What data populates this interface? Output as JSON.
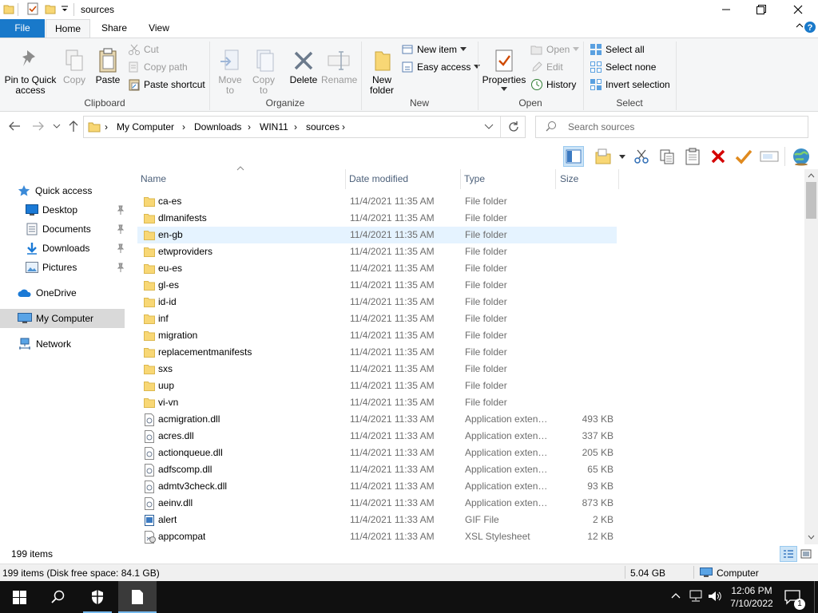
{
  "window": {
    "title": "sources",
    "controls": {
      "minimize": "minimize",
      "maximize": "maximize",
      "close": "close"
    }
  },
  "ribbon": {
    "tabs": [
      "File",
      "Home",
      "Share",
      "View"
    ],
    "active_tab": "Home",
    "clipboard": {
      "pin_line1": "Pin to Quick",
      "pin_line2": "access",
      "copy": "Copy",
      "paste": "Paste",
      "cut": "Cut",
      "copy_path": "Copy path",
      "paste_shortcut": "Paste shortcut",
      "label": "Clipboard"
    },
    "organize": {
      "move_line1": "Move",
      "move_line2": "to",
      "copy_line1": "Copy",
      "copy_line2": "to",
      "delete": "Delete",
      "rename": "Rename",
      "label": "Organize"
    },
    "new": {
      "folder_line1": "New",
      "folder_line2": "folder",
      "new_item": "New item",
      "easy_access": "Easy access",
      "label": "New"
    },
    "open": {
      "properties": "Properties",
      "open": "Open",
      "edit": "Edit",
      "history": "History",
      "label": "Open"
    },
    "select": {
      "select_all": "Select all",
      "select_none": "Select none",
      "invert": "Invert selection",
      "label": "Select"
    }
  },
  "address": {
    "breadcrumbs": [
      "My Computer",
      "Downloads",
      "WIN11",
      "sources"
    ],
    "search_placeholder": "Search sources"
  },
  "nav": {
    "quick_access": "Quick access",
    "pinned": [
      "Desktop",
      "Documents",
      "Downloads",
      "Pictures"
    ],
    "onedrive": "OneDrive",
    "my_computer": "My Computer",
    "network": "Network"
  },
  "columns": {
    "name": "Name",
    "date": "Date modified",
    "type": "Type",
    "size": "Size"
  },
  "files": [
    {
      "name": "ca-es",
      "date": "11/4/2021 11:35 AM",
      "type": "File folder",
      "size": "",
      "icon": "folder-icon"
    },
    {
      "name": "dlmanifests",
      "date": "11/4/2021 11:35 AM",
      "type": "File folder",
      "size": "",
      "icon": "folder-icon"
    },
    {
      "name": "en-gb",
      "date": "11/4/2021 11:35 AM",
      "type": "File folder",
      "size": "",
      "icon": "folder-icon"
    },
    {
      "name": "etwproviders",
      "date": "11/4/2021 11:35 AM",
      "type": "File folder",
      "size": "",
      "icon": "folder-icon"
    },
    {
      "name": "eu-es",
      "date": "11/4/2021 11:35 AM",
      "type": "File folder",
      "size": "",
      "icon": "folder-icon"
    },
    {
      "name": "gl-es",
      "date": "11/4/2021 11:35 AM",
      "type": "File folder",
      "size": "",
      "icon": "folder-icon"
    },
    {
      "name": "id-id",
      "date": "11/4/2021 11:35 AM",
      "type": "File folder",
      "size": "",
      "icon": "folder-icon"
    },
    {
      "name": "inf",
      "date": "11/4/2021 11:35 AM",
      "type": "File folder",
      "size": "",
      "icon": "folder-icon"
    },
    {
      "name": "migration",
      "date": "11/4/2021 11:35 AM",
      "type": "File folder",
      "size": "",
      "icon": "folder-icon"
    },
    {
      "name": "replacementmanifests",
      "date": "11/4/2021 11:35 AM",
      "type": "File folder",
      "size": "",
      "icon": "folder-icon"
    },
    {
      "name": "sxs",
      "date": "11/4/2021 11:35 AM",
      "type": "File folder",
      "size": "",
      "icon": "folder-icon"
    },
    {
      "name": "uup",
      "date": "11/4/2021 11:35 AM",
      "type": "File folder",
      "size": "",
      "icon": "folder-icon"
    },
    {
      "name": "vi-vn",
      "date": "11/4/2021 11:35 AM",
      "type": "File folder",
      "size": "",
      "icon": "folder-icon"
    },
    {
      "name": "acmigration.dll",
      "date": "11/4/2021 11:33 AM",
      "type": "Application exten…",
      "size": "493 KB",
      "icon": "dll-file-icon"
    },
    {
      "name": "acres.dll",
      "date": "11/4/2021 11:33 AM",
      "type": "Application exten…",
      "size": "337 KB",
      "icon": "dll-file-icon"
    },
    {
      "name": "actionqueue.dll",
      "date": "11/4/2021 11:33 AM",
      "type": "Application exten…",
      "size": "205 KB",
      "icon": "dll-file-icon"
    },
    {
      "name": "adfscomp.dll",
      "date": "11/4/2021 11:33 AM",
      "type": "Application exten…",
      "size": "65 KB",
      "icon": "dll-file-icon"
    },
    {
      "name": "admtv3check.dll",
      "date": "11/4/2021 11:33 AM",
      "type": "Application exten…",
      "size": "93 KB",
      "icon": "dll-file-icon"
    },
    {
      "name": "aeinv.dll",
      "date": "11/4/2021 11:33 AM",
      "type": "Application exten…",
      "size": "873 KB",
      "icon": "dll-file-icon"
    },
    {
      "name": "alert",
      "date": "11/4/2021 11:33 AM",
      "type": "GIF File",
      "size": "2 KB",
      "icon": "gif-file-icon"
    },
    {
      "name": "appcompat",
      "date": "11/4/2021 11:33 AM",
      "type": "XSL Stylesheet",
      "size": "12 KB",
      "icon": "xsl-file-icon"
    }
  ],
  "highlighted_row": "en-gb",
  "item_count": "199 items",
  "statusbar": {
    "left": "199 items (Disk free space: 84.1 GB)",
    "size": "5.04 GB",
    "location": "Computer"
  },
  "taskbar": {
    "time": "12:06 PM",
    "date": "7/10/2022",
    "notifications": "1"
  },
  "colors": {
    "file_tab": "#1979ca",
    "folder": "#f8d775",
    "highlight_row": "#e5f3ff",
    "taskbar": "#101010"
  }
}
